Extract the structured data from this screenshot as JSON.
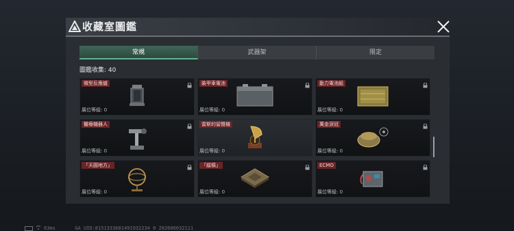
{
  "header": {
    "title": "收藏室圖鑑"
  },
  "tabs": [
    {
      "label": "常規",
      "active": true
    },
    {
      "label": "武器架",
      "active": false
    },
    {
      "label": "限定",
      "active": false
    }
  ],
  "collection": {
    "label": "圖鑑收集: 40"
  },
  "cards": [
    {
      "name": "微型反應爐",
      "level": "展位等級: 0",
      "locked": true,
      "icon": "reactor-icon"
    },
    {
      "name": "裝甲車電池",
      "level": "展位等級: 0",
      "locked": true,
      "icon": "battery-icon"
    },
    {
      "name": "動力電池組",
      "level": "展位等級: 0",
      "locked": true,
      "icon": "power-cell-icon"
    },
    {
      "name": "醫療機器人",
      "level": "展位等級: 0",
      "locked": true,
      "icon": "robot-arm-icon"
    },
    {
      "name": "雷斯的留聲機",
      "level": "展位等級: 0",
      "locked": false,
      "icon": "gramophone-icon"
    },
    {
      "name": "萬金淚冠",
      "level": "展位等級: 0",
      "locked": true,
      "icon": "crown-icon"
    },
    {
      "name": "「天圓地方」",
      "level": "展位等級: 0",
      "locked": true,
      "icon": "armillary-icon"
    },
    {
      "name": "「縱橫」",
      "level": "展位等級: 0",
      "locked": true,
      "icon": "chessboard-icon"
    },
    {
      "name": "ECMO",
      "level": "展位等級: 0",
      "locked": true,
      "icon": "ecmo-icon"
    }
  ],
  "status": {
    "ping": "63ms",
    "uid": "GA UID:8151333681491932234 0 202606032111"
  },
  "colors": {
    "accent": "#62b58f",
    "tag": "#6a2426",
    "panel": "#2a2e33"
  }
}
